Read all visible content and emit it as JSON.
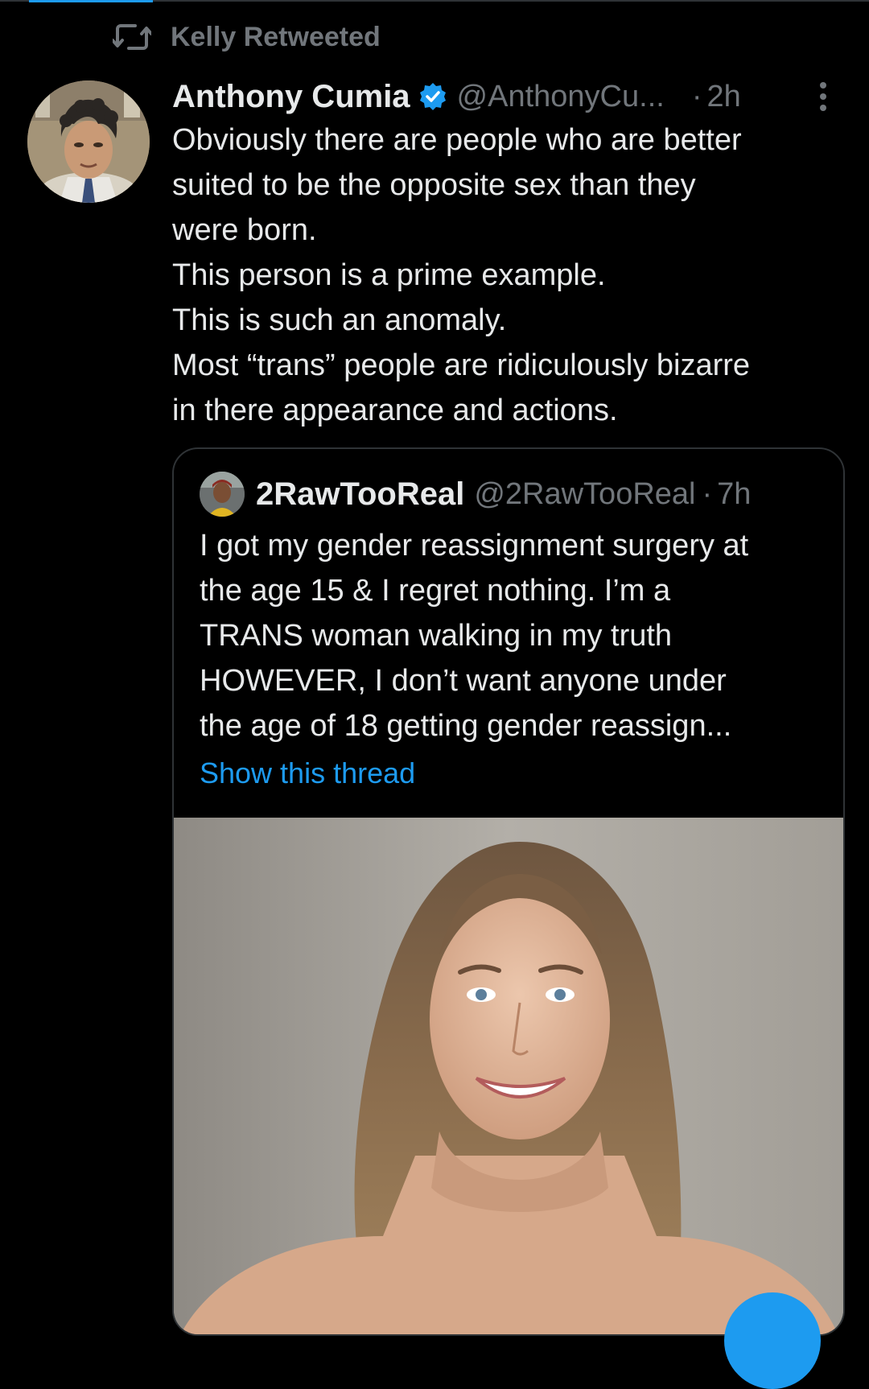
{
  "colors": {
    "background": "#000000",
    "primary_text": "#e7e9ea",
    "secondary_text": "#71767b",
    "accent": "#1d9bf0",
    "border": "#2f3336"
  },
  "social_context": {
    "icon": "retweet-icon",
    "label": "Kelly Retweeted"
  },
  "tweet": {
    "author_name": "Anthony Cumia",
    "verified": true,
    "handle": "@AnthonyCu...",
    "separator": "·",
    "time": "2h",
    "more_icon": "more-vertical-icon",
    "text_lines": [
      "Obviously there are people who are better",
      "suited to be the opposite sex than they",
      "were born.",
      "This person is a prime example.",
      "This is such an anomaly.",
      "Most “trans” people are ridiculously bizarre",
      "in there appearance and actions."
    ]
  },
  "quoted_tweet": {
    "author_name": "2RawTooReal",
    "handle": "@2RawTooReal",
    "separator": "·",
    "time": "7h",
    "text_lines": [
      "I got my gender reassignment surgery at",
      "the age 15 & I regret nothing. I’m a",
      "TRANS woman walking in my truth",
      "HOWEVER, I don’t want anyone under",
      "the age of 18 getting gender reassign..."
    ],
    "show_thread_label": "Show this thread"
  }
}
